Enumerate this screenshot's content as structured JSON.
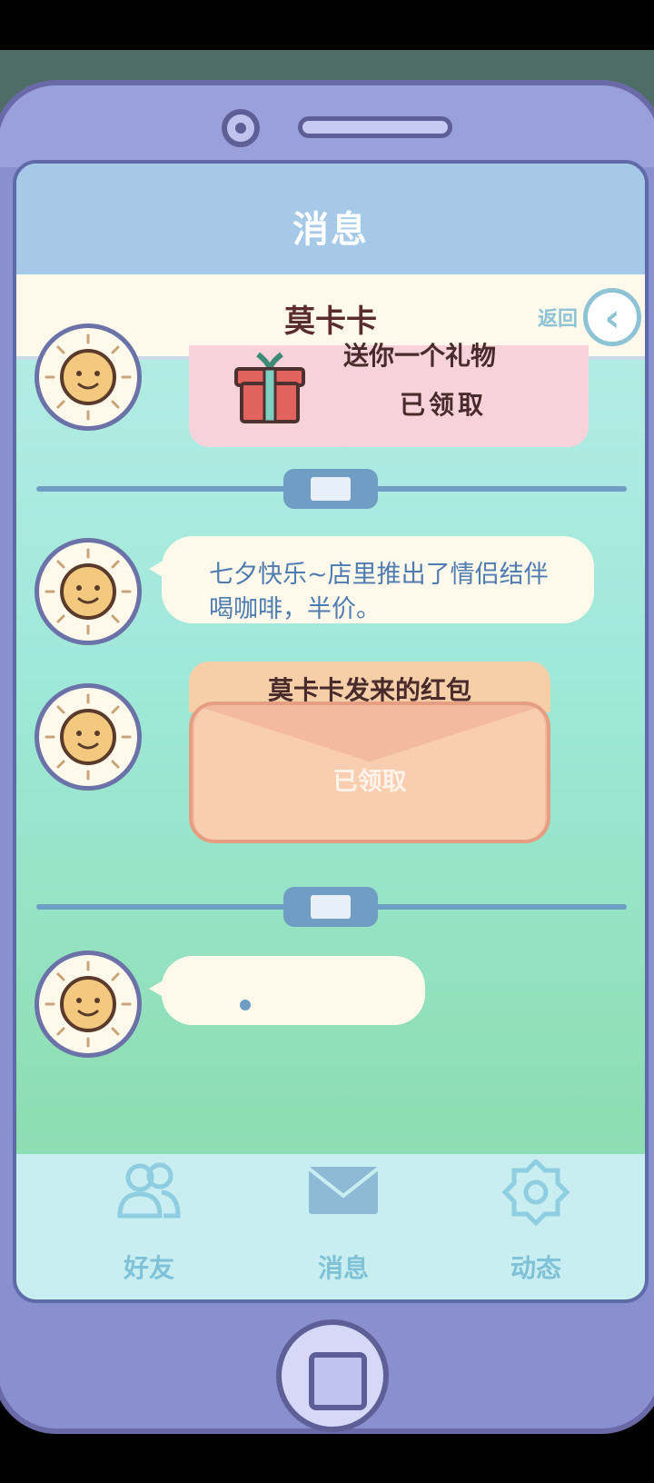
{
  "header": {
    "title": "消息"
  },
  "chat": {
    "contact_name": "莫卡卡",
    "back_label": "返回"
  },
  "messages": {
    "gift": {
      "text": "送你一个礼物",
      "status": "已领取"
    },
    "text_message": "七夕快乐~店里推出了情侣结伴喝咖啡，半价。",
    "red_packet": {
      "title": "莫卡卡发来的红包",
      "status": "已领取"
    }
  },
  "tabs": [
    {
      "label": "好友",
      "icon": "friends-icon"
    },
    {
      "label": "消息",
      "icon": "mail-icon"
    },
    {
      "label": "动态",
      "icon": "moments-icon"
    }
  ],
  "colors": {
    "accent": "#6f9dc3",
    "tab_label": "#7fc2d8",
    "phone_frame": "#8a8fcf"
  }
}
